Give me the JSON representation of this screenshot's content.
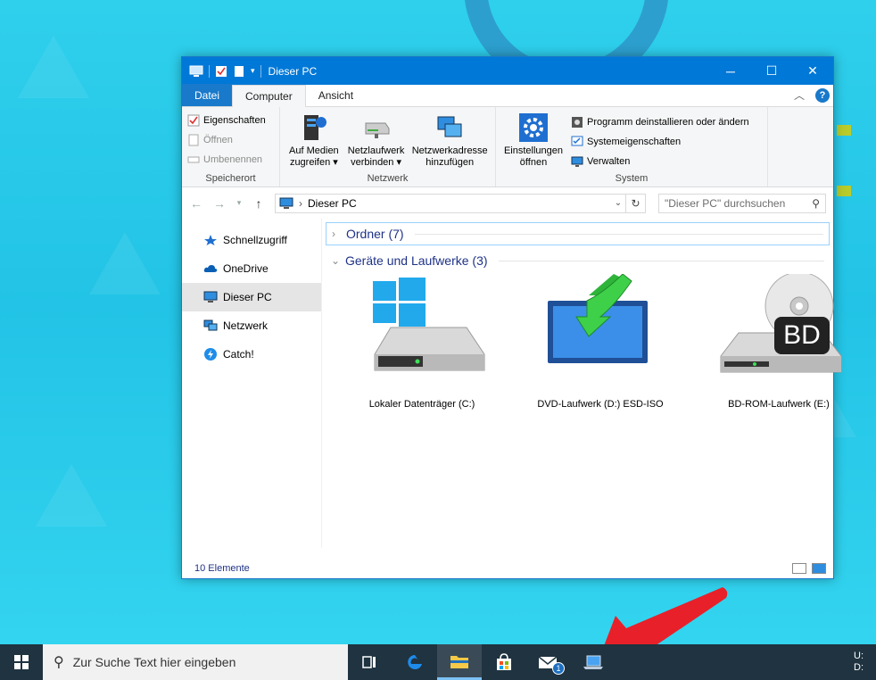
{
  "window": {
    "title": "Dieser PC",
    "tabs": [
      "Datei",
      "Computer",
      "Ansicht"
    ],
    "help": "?"
  },
  "ribbon": {
    "speicherort": {
      "label": "Speicherort",
      "items": [
        "Eigenschaften",
        "Öffnen",
        "Umbenennen"
      ]
    },
    "netzwerk": {
      "label": "Netzwerk",
      "items": [
        {
          "l1": "Auf Medien",
          "l2": "zugreifen ▾"
        },
        {
          "l1": "Netzlaufwerk",
          "l2": "verbinden ▾"
        },
        {
          "l1": "Netzwerkadresse",
          "l2": "hinzufügen"
        }
      ]
    },
    "system": {
      "label": "System",
      "settings": {
        "l1": "Einstellungen",
        "l2": "öffnen"
      },
      "items": [
        "Programm deinstallieren oder ändern",
        "Systemeigenschaften",
        "Verwalten"
      ]
    }
  },
  "address": {
    "path": "Dieser PC",
    "search_placeholder": "\"Dieser PC\" durchsuchen"
  },
  "nav": {
    "items": [
      "Schnellzugriff",
      "OneDrive",
      "Dieser PC",
      "Netzwerk",
      "Catch!"
    ]
  },
  "content": {
    "folders": "Ordner (7)",
    "devices": "Geräte und Laufwerke (3)",
    "drives": [
      {
        "label": "Lokaler Datenträger (C:)",
        "icon": "hdd-windows-icon"
      },
      {
        "label": "DVD-Laufwerk (D:) ESD-ISO",
        "icon": "dvd-mount-icon"
      },
      {
        "label": "BD-ROM-Laufwerk (E:)",
        "icon": "bd-drive-icon",
        "badge": "BD"
      }
    ]
  },
  "status": {
    "count": "10 Elemente"
  },
  "taskbar": {
    "search_placeholder": "Zur Suche Text hier eingeben",
    "mail_badge": "1",
    "tray_line1": "U:",
    "tray_line2": "D:"
  },
  "colors": {
    "accent": "#0078d7",
    "arrow": "#e8202a",
    "taskbar": "#1f3340"
  }
}
